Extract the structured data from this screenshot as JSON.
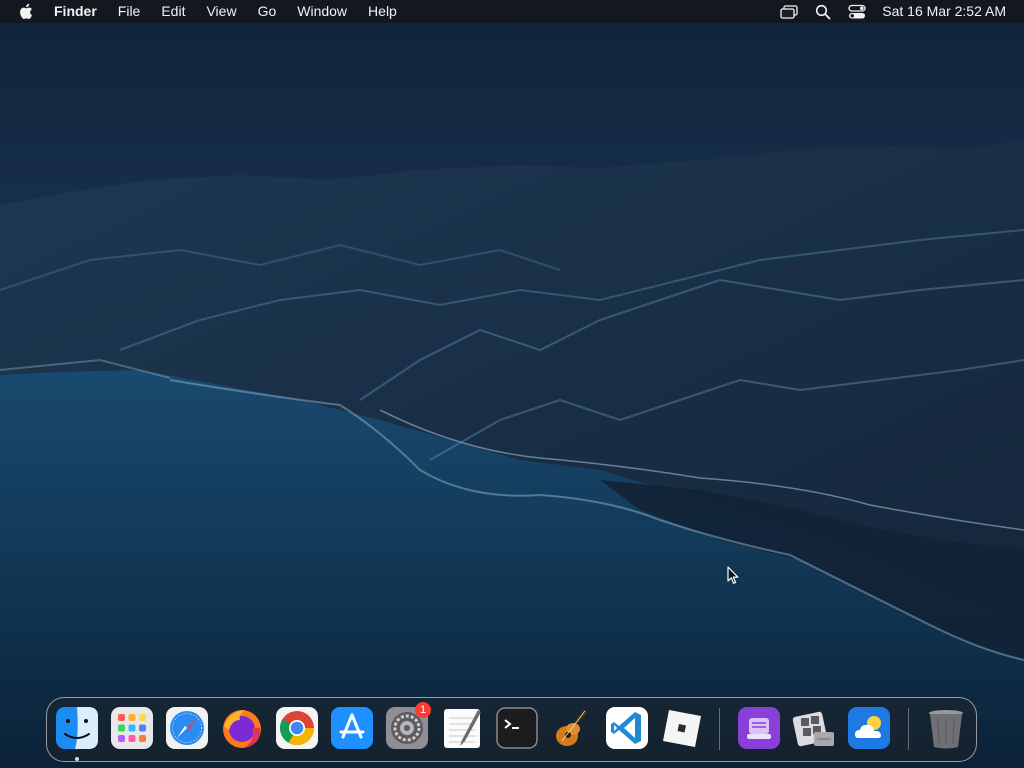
{
  "menubar": {
    "apple_icon": "apple-logo-icon",
    "app_name": "Finder",
    "items": [
      "File",
      "Edit",
      "View",
      "Go",
      "Window",
      "Help"
    ],
    "status_icons": [
      "screen-mirroring-icon",
      "spotlight-search-icon",
      "control-center-icon"
    ],
    "clock": "Sat 16 Mar  2:52 AM"
  },
  "dock": {
    "apps": [
      {
        "name": "Finder",
        "icon": "finder-icon",
        "running": true
      },
      {
        "name": "Launchpad",
        "icon": "launchpad-icon"
      },
      {
        "name": "Safari",
        "icon": "safari-icon"
      },
      {
        "name": "Firefox",
        "icon": "firefox-icon"
      },
      {
        "name": "Google Chrome",
        "icon": "chrome-icon"
      },
      {
        "name": "App Store",
        "icon": "app-store-icon"
      },
      {
        "name": "System Preferences",
        "icon": "system-preferences-icon",
        "badge": "1"
      },
      {
        "name": "TextEdit",
        "icon": "textedit-icon"
      },
      {
        "name": "Terminal",
        "icon": "terminal-icon"
      },
      {
        "name": "GarageBand",
        "icon": "garageband-icon"
      },
      {
        "name": "Visual Studio Code",
        "icon": "vscode-icon"
      },
      {
        "name": "Roblox",
        "icon": "roblox-icon"
      }
    ],
    "recent_apps": [
      {
        "name": "Podcasts",
        "icon": "purple-app-icon"
      },
      {
        "name": "Boot Camp Assistant",
        "icon": "boot-camp-icon"
      },
      {
        "name": "Weather",
        "icon": "weather-icon"
      }
    ],
    "trash": {
      "name": "Trash",
      "icon": "trash-icon"
    }
  },
  "colors": {
    "menubar_bg": "#14181e",
    "badge": "#ff3b30",
    "sky": "#1d3a58",
    "sea": "#0f2f4d"
  }
}
